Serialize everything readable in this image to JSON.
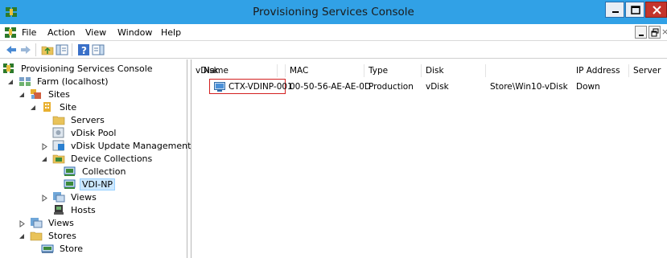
{
  "window": {
    "title": "Provisioning Services Console"
  },
  "menu": {
    "items": [
      "File",
      "Action",
      "View",
      "Window",
      "Help"
    ]
  },
  "tree": {
    "root": "Provisioning Services Console",
    "farm": "Farm (localhost)",
    "sites": "Sites",
    "site": "Site",
    "servers": "Servers",
    "vdisk_pool": "vDisk Pool",
    "vdisk_update": "vDisk Update Management",
    "device_collections": "Device Collections",
    "collection": "Collection",
    "vdi_np": "VDI-NP",
    "site_views": "Views",
    "hosts": "Hosts",
    "farm_views": "Views",
    "stores": "Stores",
    "store": "Store"
  },
  "list": {
    "columns": [
      "Name",
      "MAC",
      "Type",
      "Disk",
      "vDisk",
      "IP Address",
      "Server"
    ],
    "rows": [
      {
        "name": "CTX-VDINP-001",
        "mac": "00-50-56-AE-AE-0D",
        "type": "Production",
        "disk": "vDisk",
        "vdisk": "Store\\Win10-vDisk",
        "ip": "Down",
        "server": ""
      }
    ]
  },
  "colors": {
    "titlebar": "#31a1e6",
    "selection": "#cce8ff",
    "highlight_box": "#d32020",
    "close_button": "#c4352c"
  }
}
